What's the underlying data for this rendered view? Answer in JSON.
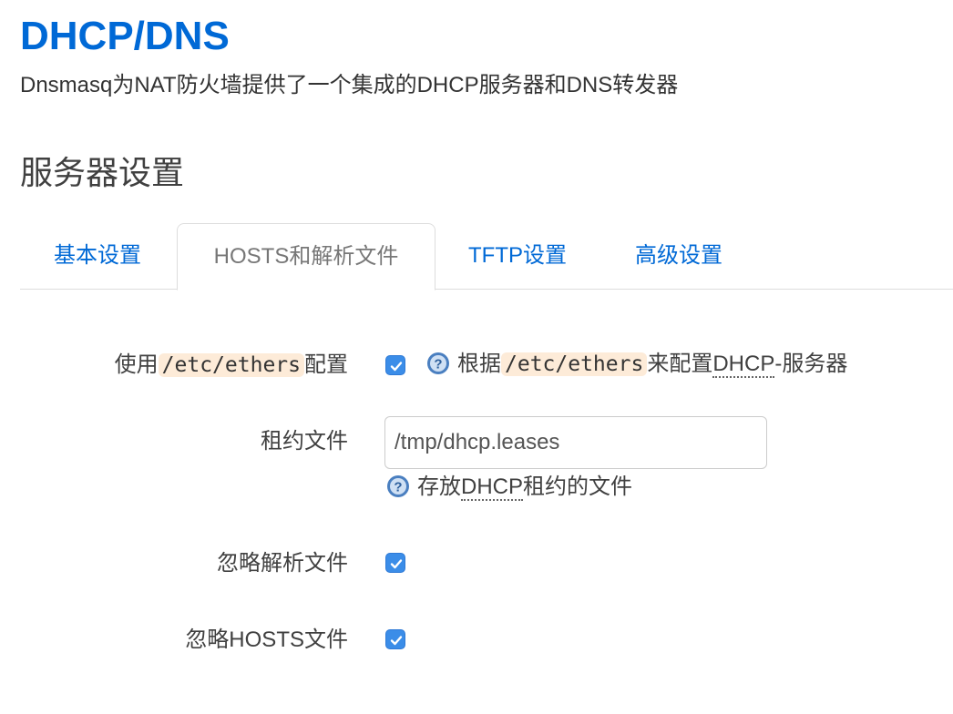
{
  "page": {
    "title": "DHCP/DNS",
    "description": "Dnsmasq为NAT防火墙提供了一个集成的DHCP服务器和DNS转发器"
  },
  "section": {
    "title": "服务器设置"
  },
  "tabs": [
    {
      "label": "基本设置",
      "active": false
    },
    {
      "label": "HOSTS和解析文件",
      "active": true
    },
    {
      "label": "TFTP设置",
      "active": false
    },
    {
      "label": "高级设置",
      "active": false
    }
  ],
  "fields": {
    "use_ethers": {
      "label_prefix": "使用",
      "label_code": "/etc/ethers",
      "label_suffix": "配置",
      "checked": true,
      "help_prefix": "根据",
      "help_code": "/etc/ethers",
      "help_middle": "来配置",
      "help_abbr": "DHCP",
      "help_suffix": "-服务器"
    },
    "lease_file": {
      "label": "租约文件",
      "value": "/tmp/dhcp.leases",
      "help_prefix": "存放",
      "help_abbr": "DHCP",
      "help_suffix": "租约的文件"
    },
    "ignore_resolv": {
      "label": "忽略解析文件",
      "checked": true
    },
    "ignore_hosts": {
      "label": "忽略HOSTS文件",
      "checked": true
    }
  },
  "icons": {
    "help": "help-icon",
    "check": "checkmark-icon"
  },
  "colors": {
    "link": "#0069d6",
    "checkbox": "#3b8de8",
    "code_bg": "#fdebd8"
  }
}
